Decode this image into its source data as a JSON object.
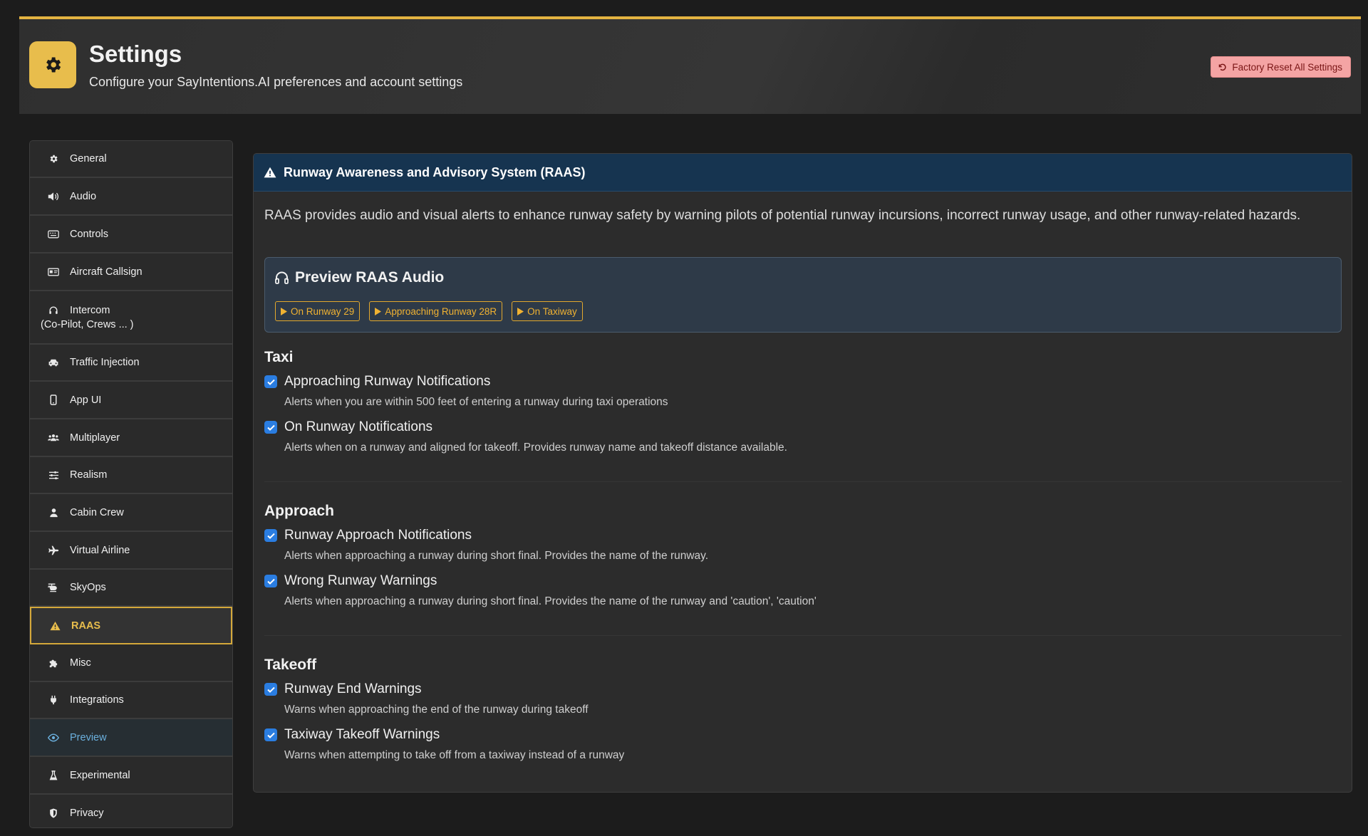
{
  "header": {
    "title": "Settings",
    "subtitle": "Configure your SayIntentions.AI preferences and account settings",
    "reset_label": "Factory Reset All Settings",
    "accent_color": "#e8bd4c"
  },
  "sidebar": {
    "items": [
      {
        "label": "General",
        "icon": "gear-icon"
      },
      {
        "label": "Audio",
        "icon": "speaker-icon"
      },
      {
        "label": "Controls",
        "icon": "keyboard-icon"
      },
      {
        "label": "Aircraft Callsign",
        "icon": "id-card-icon"
      },
      {
        "label": "Intercom",
        "label2": "(Co-Pilot, Crews ... )",
        "icon": "headset-icon"
      },
      {
        "label": "Traffic Injection",
        "icon": "car-icon"
      },
      {
        "label": "App UI",
        "icon": "mobile-icon"
      },
      {
        "label": "Multiplayer",
        "icon": "users-icon"
      },
      {
        "label": "Realism",
        "icon": "sliders-icon"
      },
      {
        "label": "Cabin Crew",
        "icon": "user-icon"
      },
      {
        "label": "Virtual Airline",
        "icon": "plane-icon"
      },
      {
        "label": "SkyOps",
        "icon": "helicopter-icon"
      },
      {
        "label": "RAAS",
        "icon": "warning-icon"
      },
      {
        "label": "Misc",
        "icon": "puzzle-icon"
      },
      {
        "label": "Integrations",
        "icon": "plug-icon"
      },
      {
        "label": "Preview",
        "icon": "eye-icon"
      },
      {
        "label": "Experimental",
        "icon": "flask-icon"
      },
      {
        "label": "Privacy",
        "icon": "shield-icon"
      }
    ],
    "active": "RAAS"
  },
  "panel": {
    "title": "Runway Awareness and Advisory System (RAAS)",
    "description": "RAAS provides audio and visual alerts to enhance runway safety by warning pilots of potential runway incursions, incorrect runway usage, and other runway-related hazards.",
    "preview": {
      "title": "Preview RAAS Audio",
      "buttons": [
        "On Runway 29",
        "Approaching Runway 28R",
        "On Taxiway"
      ]
    },
    "sections": [
      {
        "title": "Taxi",
        "options": [
          {
            "label": "Approaching Runway Notifications",
            "help": "Alerts when you are within 500 feet of entering a runway during taxi operations",
            "checked": true
          },
          {
            "label": "On Runway Notifications",
            "help": "Alerts when on a runway and aligned for takeoff. Provides runway name and takeoff distance available.",
            "checked": true
          }
        ]
      },
      {
        "title": "Approach",
        "options": [
          {
            "label": "Runway Approach Notifications",
            "help": "Alerts when approaching a runway during short final. Provides the name of the runway.",
            "checked": true
          },
          {
            "label": "Wrong Runway Warnings",
            "help": "Alerts when approaching a runway during short final. Provides the name of the runway and 'caution', 'caution'",
            "checked": true
          }
        ]
      },
      {
        "title": "Takeoff",
        "options": [
          {
            "label": "Runway End Warnings",
            "help": "Warns when approaching the end of the runway during takeoff",
            "checked": true
          },
          {
            "label": "Taxiway Takeoff Warnings",
            "help": "Warns when attempting to take off from a taxiway instead of a runway",
            "checked": true
          }
        ]
      }
    ]
  }
}
